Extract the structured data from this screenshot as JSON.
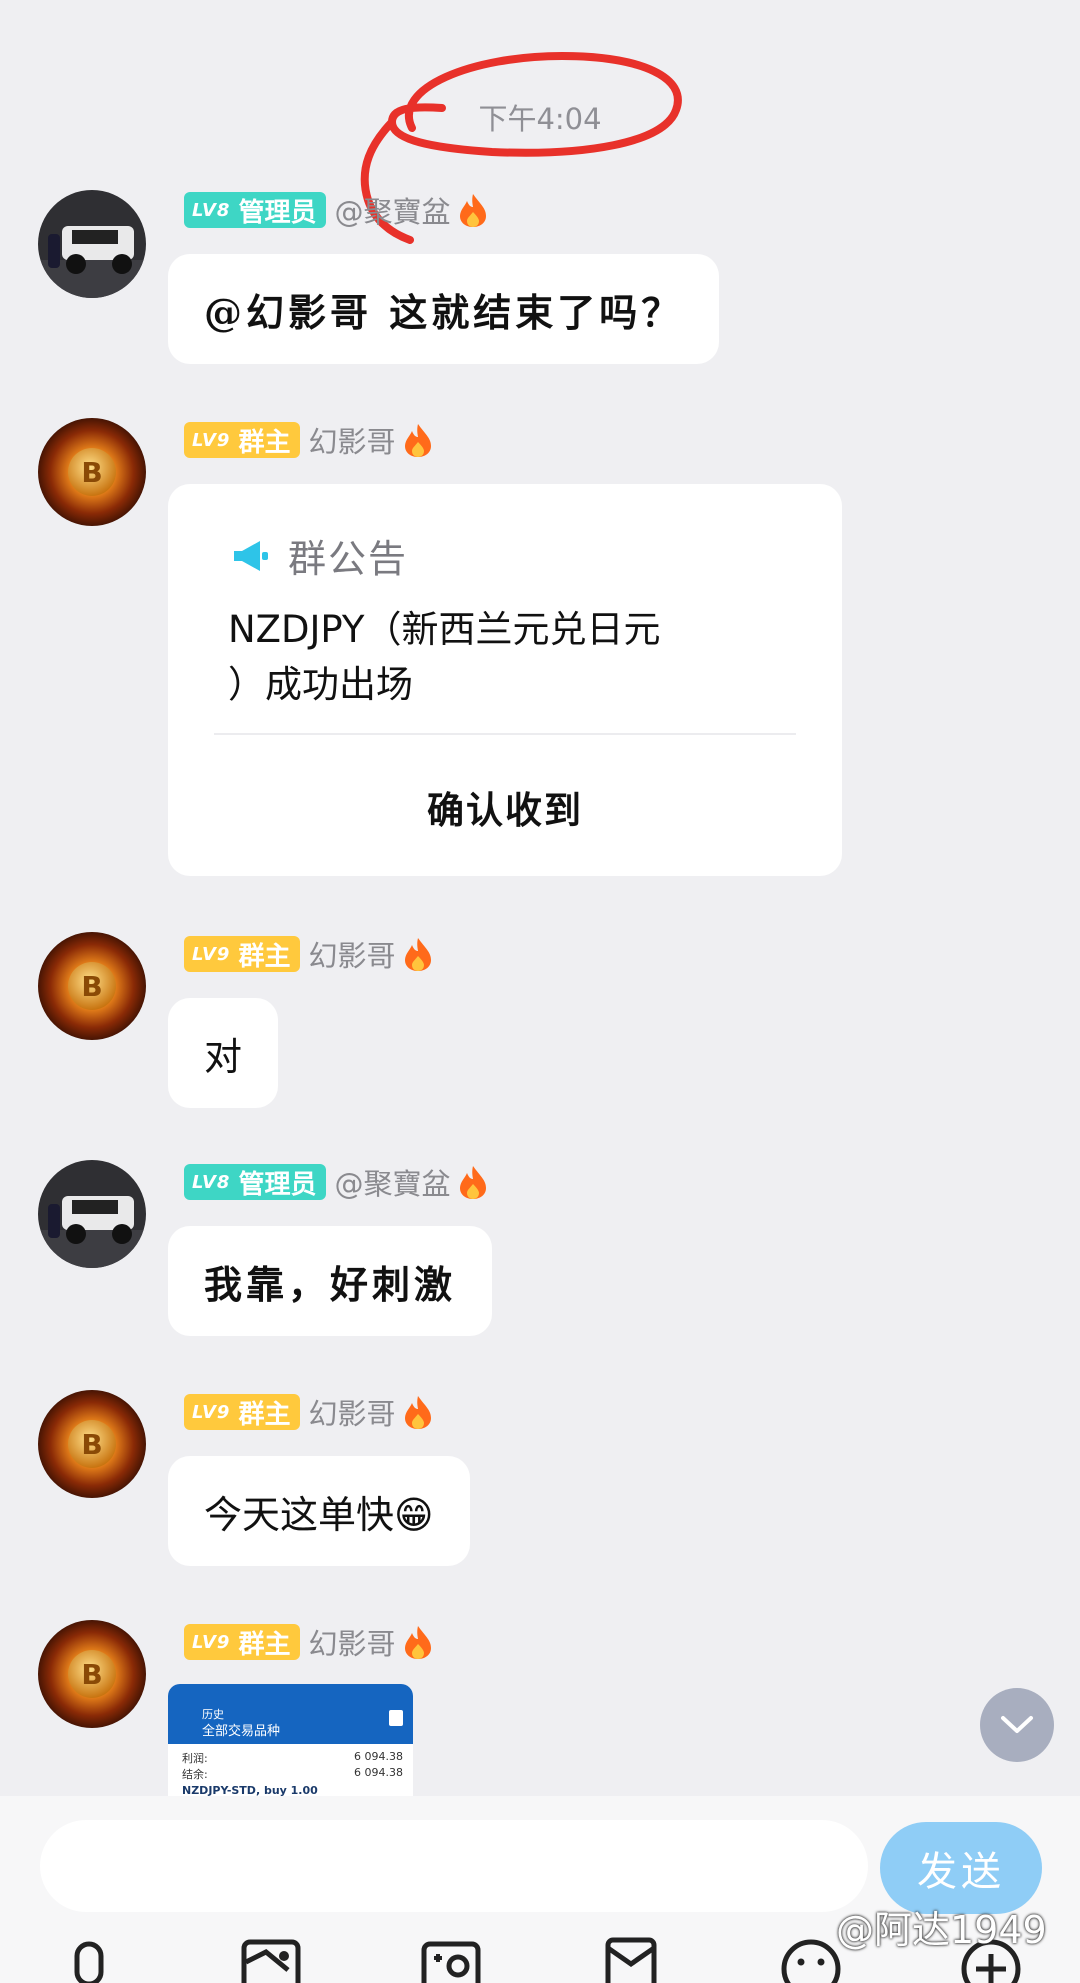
{
  "chat": {
    "timestamp": "下午4:04",
    "messages": [
      {
        "badge_level": "LV8",
        "badge_role": "管理员",
        "sender": "@聚寶盆",
        "text": "@幻影哥 这就结束了吗？"
      },
      {
        "badge_level": "LV9",
        "badge_role": "群主",
        "sender": "幻影哥",
        "notice": {
          "label": "群公告",
          "body_line1": "NZDJPY（新西兰元兑日元",
          "body_line2": "）成功出场",
          "confirm": "确认收到"
        }
      },
      {
        "badge_level": "LV9",
        "badge_role": "群主",
        "sender": "幻影哥",
        "text": "对"
      },
      {
        "badge_level": "LV8",
        "badge_role": "管理员",
        "sender": "@聚寶盆",
        "text": "我靠，好刺激"
      },
      {
        "badge_level": "LV9",
        "badge_role": "群主",
        "sender": "幻影哥",
        "text": "今天这单快😁"
      },
      {
        "badge_level": "LV9",
        "badge_role": "群主",
        "sender": "幻影哥",
        "image": {
          "title1": "历史",
          "title2": "全部交易品种",
          "row1_label": "利润:",
          "row1_value": "6 094.38",
          "row2_label": "结余:",
          "row2_value": "6 094.38",
          "row3_label": "NZDJPY-STD, buy 1.00"
        }
      }
    ]
  },
  "composer": {
    "placeholder": "",
    "send_label": "发送"
  },
  "toolbar": {
    "icons": [
      "microphone-icon",
      "gallery-icon",
      "camera-icon",
      "red-packet-icon",
      "emoji-icon",
      "plus-icon"
    ]
  },
  "watermark": "@阿达1949",
  "colors": {
    "admin_badge": "#3ed6c5",
    "owner_badge": "#ffc93d",
    "send_button": "#8fcdf6",
    "annotation": "#e8312a"
  }
}
